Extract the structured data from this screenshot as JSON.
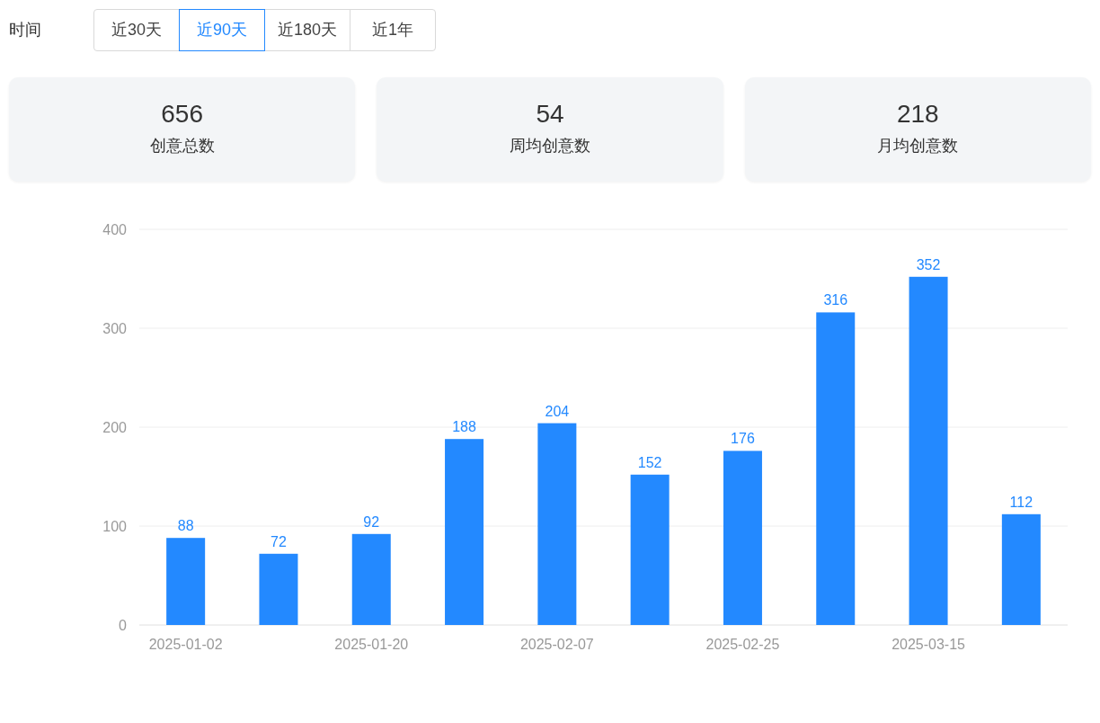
{
  "filter": {
    "label": "时间",
    "options": [
      {
        "label": "近30天",
        "selected": false
      },
      {
        "label": "近90天",
        "selected": true
      },
      {
        "label": "近180天",
        "selected": false
      },
      {
        "label": "近1年",
        "selected": false
      }
    ]
  },
  "stats": [
    {
      "value": "656",
      "label": "创意总数"
    },
    {
      "value": "54",
      "label": "周均创意数"
    },
    {
      "value": "218",
      "label": "月均创意数"
    }
  ],
  "chart": {
    "chart_data": {
      "type": "bar",
      "categories": [
        "2025-01-02",
        null,
        "2025-01-20",
        null,
        "2025-02-07",
        null,
        "2025-02-25",
        null,
        "2025-03-15",
        null
      ],
      "series": [
        {
          "color": "#2389ff",
          "values": [
            88,
            72,
            92,
            188,
            204,
            152,
            176,
            316,
            352,
            112
          ]
        }
      ],
      "ylim": [
        0,
        400
      ],
      "yticks": [
        0,
        100,
        200,
        300,
        400
      ],
      "data_labels": true,
      "grid": true
    }
  }
}
